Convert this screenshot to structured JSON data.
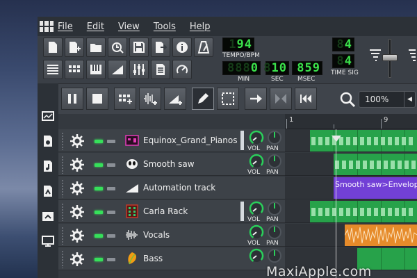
{
  "menu": [
    "File",
    "Edit",
    "View",
    "Tools",
    "Help"
  ],
  "lcd": {
    "tempo": "94",
    "tempo_dim": "1",
    "tempo_label": "TEMPO/BPM",
    "min": "0",
    "min_dim": "888",
    "sec": "10",
    "sec_dim": "8",
    "msec": "859",
    "min_label": "MIN",
    "sec_label": "SEC",
    "msec_label": "MSEC",
    "timesig_num": "4",
    "timesig_den": "4",
    "timesig_dim": "8",
    "timesig_label": "TIME SIG"
  },
  "zoom": {
    "value": "100%"
  },
  "timeline": {
    "bar1": "1",
    "bar9": "9"
  },
  "knob_labels": {
    "vol": "VOL",
    "pan": "PAN"
  },
  "tracks": [
    {
      "name": "Equinox_Grand_Pianos",
      "icon": "equinox-icon"
    },
    {
      "name": "Smooth saw",
      "icon": "alien-icon"
    },
    {
      "name": "Automation track",
      "icon": "automation-ramp-icon"
    },
    {
      "name": "Carla Rack",
      "icon": "carla-rack-icon"
    },
    {
      "name": "Vocals",
      "icon": "audio-wave-icon"
    },
    {
      "name": "Bass",
      "icon": "leaf-icon"
    }
  ],
  "clips": {
    "automation_label": "Smooth saw>Envelop"
  },
  "watermark": "MaxiApple.com",
  "colors": {
    "lcd_green": "#3be24b",
    "clip_green": "#27a24a",
    "clip_purple": "#7240d6",
    "clip_orange": "#e68b2a"
  }
}
